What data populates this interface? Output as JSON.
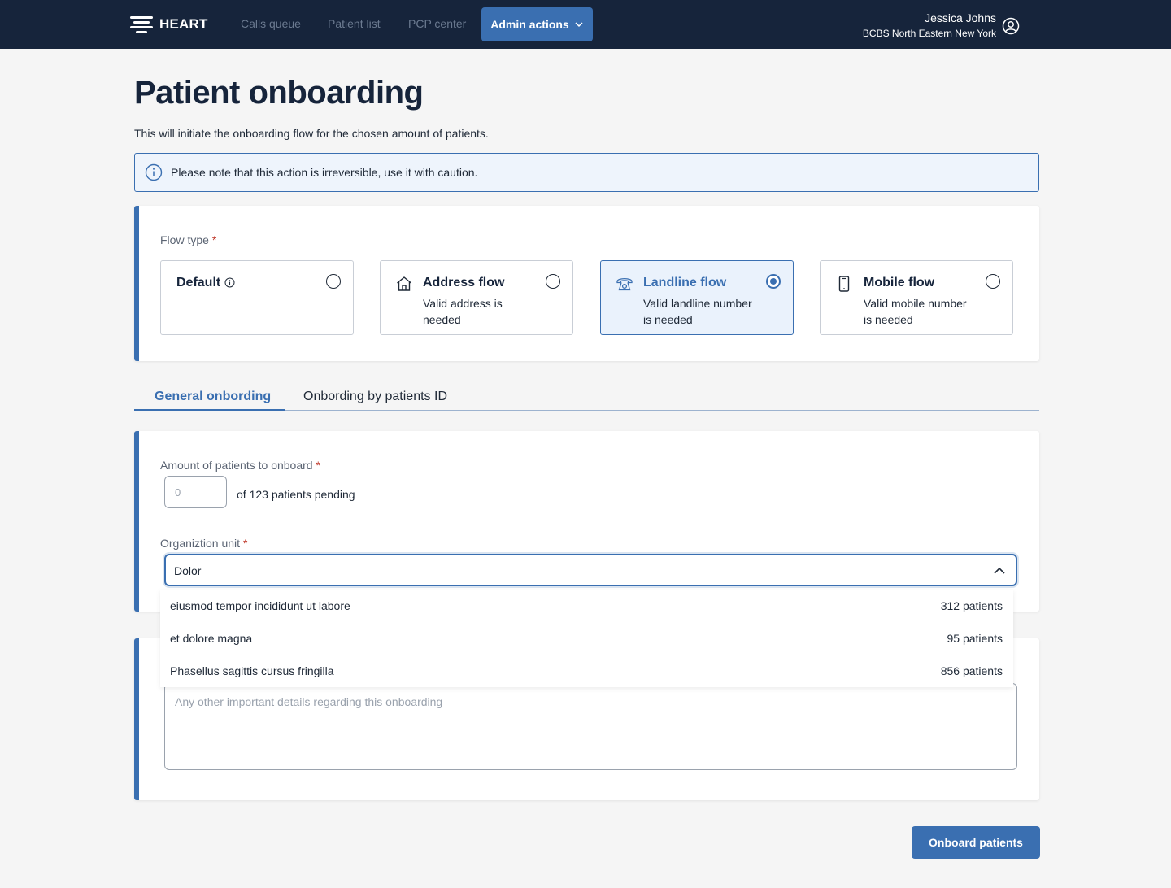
{
  "nav": {
    "logo_text": "HEART",
    "links": [
      "Calls queue",
      "Patient list",
      "PCP center"
    ],
    "active_menu": "Admin actions",
    "user_name": "Jessica Johns",
    "user_org": "BCBS North Eastern New York"
  },
  "page": {
    "title": "Patient onboarding",
    "description": "This will initiate the onboarding flow for the chosen amount of patients.",
    "notice": "Please note that this action is irreversible, use it with caution."
  },
  "flow": {
    "label": "Flow type",
    "required_mark": "*",
    "options": [
      {
        "title": "Default",
        "subtitle": "",
        "icon": "info-icon",
        "selected": false
      },
      {
        "title": "Address flow",
        "subtitle": "Valid address is needed",
        "icon": "home-icon",
        "selected": false
      },
      {
        "title": "Landline flow",
        "subtitle": "Valid landline number is needed",
        "icon": "landline-phone-icon",
        "selected": true
      },
      {
        "title": "Mobile flow",
        "subtitle": "Valid mobile number is needed",
        "icon": "mobile-phone-icon",
        "selected": false
      }
    ]
  },
  "tabs": {
    "general": "General onbording",
    "by_id": "Onbording by patients ID"
  },
  "general": {
    "amount_label": "Amount of patients to onboard",
    "amount_placeholder": "0",
    "amount_suffix": "of 123 patients pending",
    "org_label": "Organiztion unit",
    "org_value": "Dolor",
    "dropdown": [
      {
        "name": "eiusmod tempor incididunt ut labore",
        "count": "312 patients"
      },
      {
        "name": "et dolore magna",
        "count": "95 patients"
      },
      {
        "name": "Phasellus sagittis cursus fringilla",
        "count": "856 patients"
      }
    ]
  },
  "details": {
    "placeholder": "Any other important details regarding this onboarding"
  },
  "actions": {
    "submit": "Onboard patients"
  },
  "colors": {
    "nav_bg": "#16243b",
    "accent": "#3a6fb1",
    "background": "#f5f5f5"
  }
}
